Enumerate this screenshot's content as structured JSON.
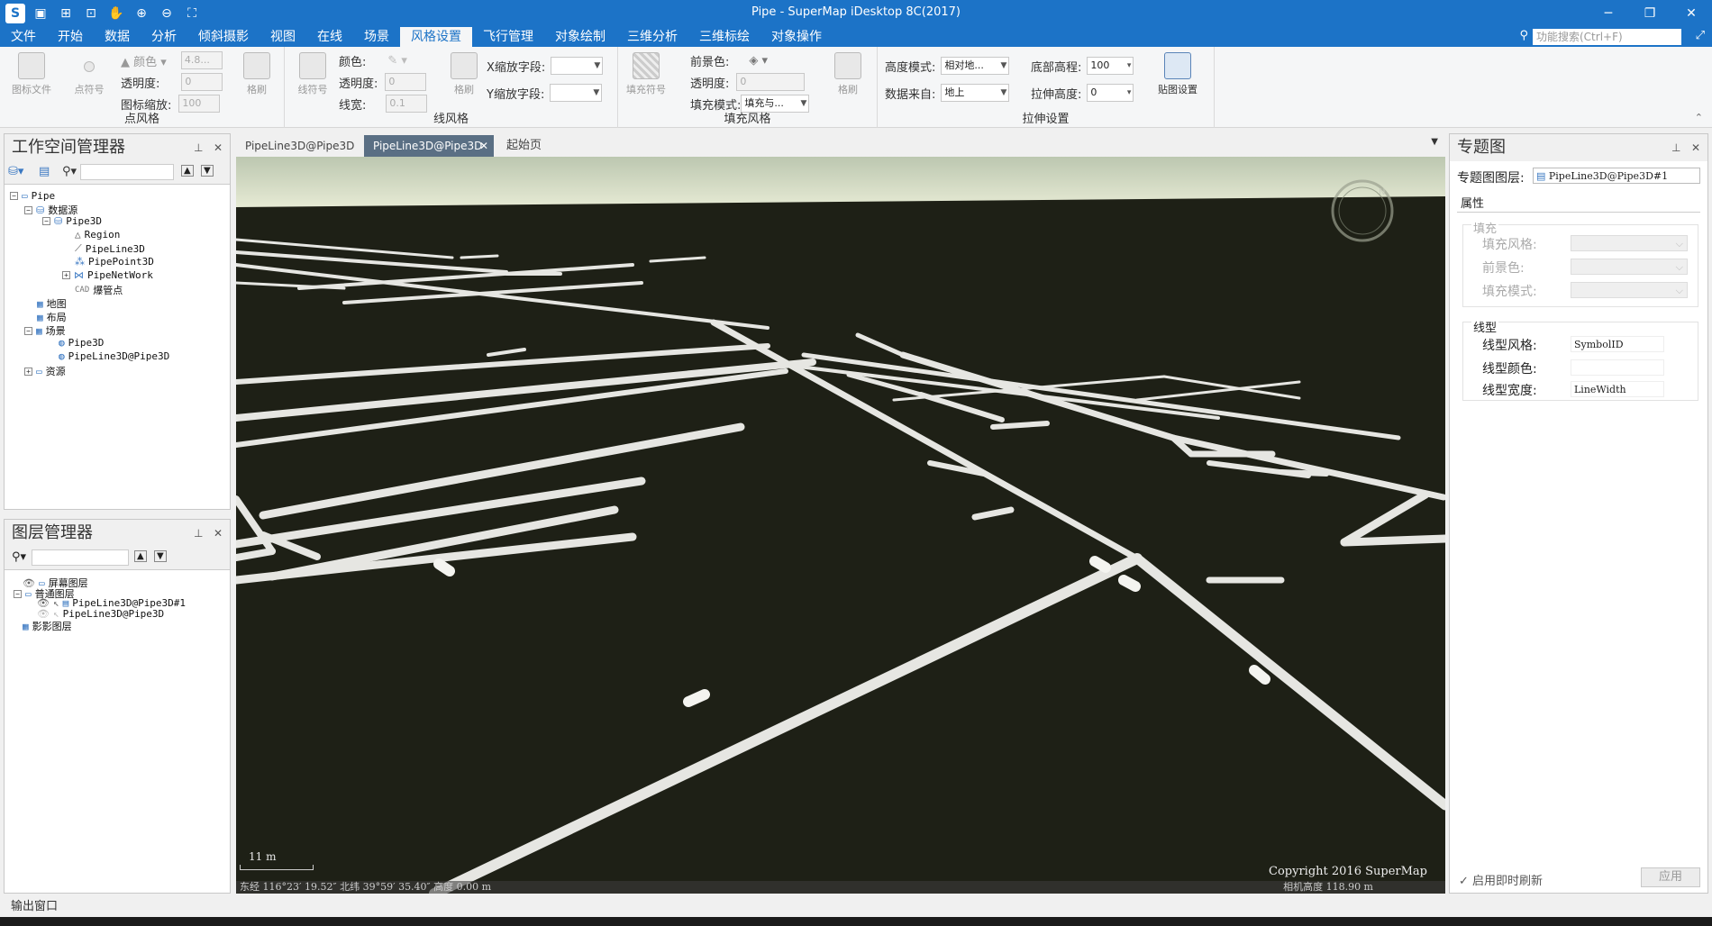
{
  "window": {
    "title": "Pipe - SuperMap iDesktop 8C(2017)"
  },
  "menu": {
    "items": [
      "文件",
      "开始",
      "数据",
      "分析",
      "倾斜摄影",
      "视图",
      "在线",
      "场景",
      "风格设置",
      "飞行管理",
      "对象绘制",
      "三维分析",
      "三维标绘",
      "对象操作"
    ],
    "search_placeholder": "功能搜索(Ctrl+F)"
  },
  "ribbon": {
    "point_style": {
      "label": "点风格",
      "symbol_lib": "图标文件",
      "symbol": "点符号",
      "color": "颜色",
      "size_value": "4.8...",
      "transparency": "透明度:",
      "transparency_value": "0",
      "icon_scale": "图标缩放:",
      "icon_scale_value": "100",
      "brush": "格刷"
    },
    "line_style": {
      "label": "线风格",
      "symbol": "线符号",
      "color": "颜色:",
      "transparency": "透明度:",
      "transparency_value": "0",
      "width": "线宽:",
      "width_value": "0.1",
      "brush": "格刷",
      "x_field": "X缩放字段:",
      "y_field": "Y缩放字段:"
    },
    "fill_style": {
      "label": "填充风格",
      "symbol": "填充符号",
      "fg_color": "前景色:",
      "transparency": "透明度:",
      "transparency_value": "0",
      "fill_mode": "填充模式:",
      "fill_mode_value": "填充与...",
      "brush": "格刷"
    },
    "extrude": {
      "label": "拉伸设置",
      "height_mode": "高度模式:",
      "height_mode_value": "相对地...",
      "data_source": "数据来自:",
      "data_source_value": "地上",
      "bottom_alt": "底部高程:",
      "bottom_alt_value": "100",
      "extrude_height": "拉伸高度:",
      "extrude_height_value": "0",
      "texture": "贴图设置"
    }
  },
  "workspace": {
    "title": "工作空间管理器",
    "tree": {
      "root": "Pipe",
      "datasources": "数据源",
      "ds_pipe3d": "Pipe3D",
      "ds_items": [
        "Region",
        "PipeLine3D",
        "PipePoint3D",
        "PipeNetWork",
        "爆管点"
      ],
      "maps": "地图",
      "layouts": "布局",
      "scenes": "场景",
      "scene_items": [
        "Pipe3D",
        "PipeLine3D@Pipe3D"
      ],
      "resources": "资源"
    }
  },
  "layers": {
    "title": "图层管理器",
    "items": [
      "屏幕图层",
      "普通图层",
      "PipeLine3D@Pipe3D#1",
      "PipeLine3D@Pipe3D",
      "影影图层"
    ]
  },
  "doctabs": {
    "tabs": [
      "PipeLine3D@Pipe3D",
      "PipeLine3D@Pipe3D",
      "起始页"
    ]
  },
  "scene": {
    "scale": "11 m",
    "copyright": "Copyright 2016 SuperMap",
    "status_left": "东经 116°23′ 19.52″   北纬 39°59′ 35.40″   高度 0.00 m",
    "status_right": "相机高度 118.90 m"
  },
  "thematic": {
    "title": "专题图",
    "layer_label": "专题图图层:",
    "layer_value": "PipeLine3D@Pipe3D#1",
    "section": "属性",
    "fill_group": "填充",
    "fill_style": "填充风格:",
    "fg_color": "前景色:",
    "fill_mode": "填充模式:",
    "line_group": "线型",
    "line_style": "线型风格:",
    "line_style_value": "SymbolID",
    "line_color": "线型颜色:",
    "line_width": "线型宽度:",
    "line_width_value": "LineWidth",
    "auto_refresh": "启用即时刷新",
    "apply": "应用"
  },
  "output": {
    "label": "输出窗口"
  },
  "colors": {
    "accent": "#1c73c7",
    "scene_bg": "#1e2016",
    "pipe": "#e6e6e2"
  }
}
